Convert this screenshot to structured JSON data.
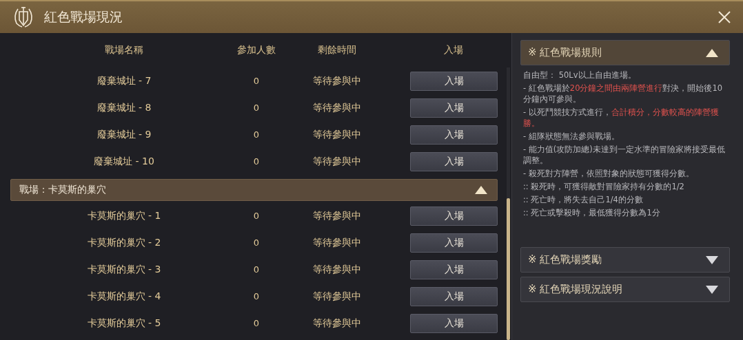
{
  "window": {
    "title": "紅色戰場現況"
  },
  "columns": [
    "戰場名稱",
    "參加人數",
    "剩餘時間",
    "入場"
  ],
  "list": [
    {
      "kind": "row",
      "name": "廢棄城址 - 7",
      "count": "0",
      "time": "等待參與中",
      "button": "入場"
    },
    {
      "kind": "row",
      "name": "廢棄城址 - 8",
      "count": "0",
      "time": "等待參與中",
      "button": "入場"
    },
    {
      "kind": "row",
      "name": "廢棄城址 - 9",
      "count": "0",
      "time": "等待參與中",
      "button": "入場"
    },
    {
      "kind": "row",
      "name": "廢棄城址 - 10",
      "count": "0",
      "time": "等待參與中",
      "button": "入場"
    },
    {
      "kind": "group",
      "title": "戰場：卡莫斯的巢穴",
      "expanded": true
    },
    {
      "kind": "row",
      "name": "卡莫斯的巢穴 - 1",
      "count": "0",
      "time": "等待參與中",
      "button": "入場"
    },
    {
      "kind": "row",
      "name": "卡莫斯的巢穴 - 2",
      "count": "0",
      "time": "等待參與中",
      "button": "入場"
    },
    {
      "kind": "row",
      "name": "卡莫斯的巢穴 - 3",
      "count": "0",
      "time": "等待參與中",
      "button": "入場"
    },
    {
      "kind": "row",
      "name": "卡莫斯的巢穴 - 4",
      "count": "0",
      "time": "等待參與中",
      "button": "入場"
    },
    {
      "kind": "row",
      "name": "卡莫斯的巢穴 - 5",
      "count": "0",
      "time": "等待參與中",
      "button": "入場"
    }
  ],
  "sections": [
    {
      "title": "※ 紅色戰場規則",
      "expanded": true,
      "lines": [
        [
          {
            "text": "自由型： 50Lv以上自由進場。",
            "highlight": false
          }
        ],
        [
          {
            "text": "- 紅色戰場於",
            "highlight": false
          },
          {
            "text": "20分鐘之間由兩陣營進行",
            "highlight": true
          },
          {
            "text": "對決，開始後10分鐘內可參與。",
            "highlight": false
          }
        ],
        [
          {
            "text": "- 以死鬥競技方式進行，",
            "highlight": false
          },
          {
            "text": "合計積分，分數較高的陣營獲勝。",
            "highlight": true
          }
        ],
        [
          {
            "text": "- 組隊狀態無法參與戰場。",
            "highlight": false
          }
        ],
        [
          {
            "text": "- 能力值(攻防加總)未達到一定水準的冒險家將接受最低調整。",
            "highlight": false
          }
        ],
        [
          {
            "text": "- 殺死對方陣營，依照對象的狀態可獲得分數。",
            "highlight": false
          }
        ],
        [
          {
            "text": ":: 殺死時，可獲得敵對冒險家持有分數的1/2",
            "highlight": false
          }
        ],
        [
          {
            "text": ":: 死亡時，將失去自己1/4的分數",
            "highlight": false
          }
        ],
        [
          {
            "text": ":: 死亡或擊殺時，最低獲得分數為1分",
            "highlight": false
          }
        ]
      ]
    },
    {
      "title": "※ 紅色戰場獎勵",
      "expanded": false
    },
    {
      "title": "※ 紅色戰場現況說明",
      "expanded": false
    }
  ]
}
